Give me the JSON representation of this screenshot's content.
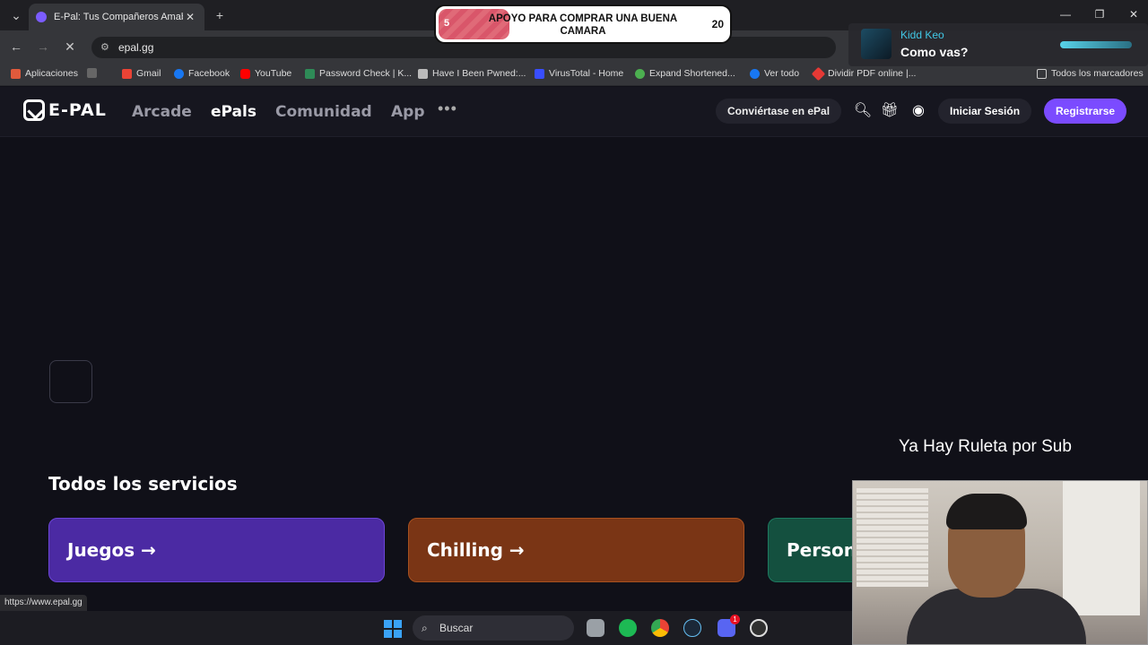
{
  "browser": {
    "tab_title": "E-Pal: Tus Compañeros Amables",
    "tab_close": "✕",
    "new_tab": "+",
    "url": "epal.gg",
    "back": "←",
    "forward": "→",
    "reload_stop": "✕",
    "window_min": "—",
    "window_max": "❐",
    "window_close": "✕"
  },
  "bookmarks": {
    "apps_label": "Aplicaciones",
    "items": [
      "Gmail",
      "Facebook",
      "YouTube",
      "Password Check | K...",
      "Have I Been Pwned:...",
      "VirusTotal - Home",
      "Expand Shortened...",
      "Ver todo",
      "Dividir PDF online |..."
    ],
    "all_bookmarks": "Todos los marcadores"
  },
  "goal_overlay": {
    "start_value": "5",
    "end_value": "20",
    "text": "APOYO PARA COMPRAR UNA BUENA CAMARA",
    "progress_fraction": 0.25
  },
  "chat_overlay": {
    "username": "Kidd Keo",
    "message": "Como vas?"
  },
  "site": {
    "logo_text": "E-PAL",
    "nav": [
      "Arcade",
      "ePals",
      "Comunidad",
      "App"
    ],
    "more": "•••",
    "become_epal": "Conviértase en ePal",
    "login": "Iniciar Sesión",
    "register": "Registrarse",
    "section_title": "Todos los servicios",
    "cards": [
      "Juegos →",
      "Chilling →",
      "Persona"
    ],
    "status_url": "https://www.epal.gg"
  },
  "stream_text": "Ya Hay Ruleta por Sub",
  "taskbar": {
    "search_placeholder": "Buscar",
    "discord_badge": "1"
  },
  "colors": {
    "accent_purple": "#7b4bff",
    "card_juegos": "#4b2aa3",
    "card_chilling": "#7a3515",
    "card_persona": "#14503f"
  }
}
